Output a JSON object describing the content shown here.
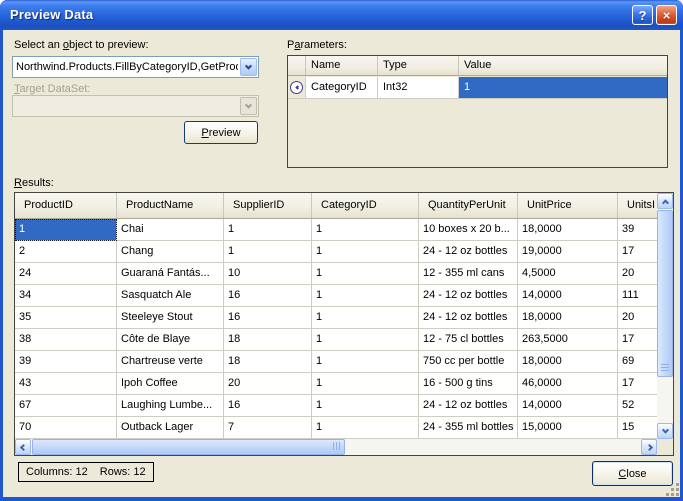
{
  "window": {
    "title": "Preview Data",
    "help_glyph": "?",
    "close_glyph": "×"
  },
  "select_object": {
    "label": {
      "pre": "Select an ",
      "key": "o",
      "post": "bject to preview:"
    },
    "value": "Northwind.Products.FillByCategoryID,GetProd"
  },
  "target_dataset": {
    "label": {
      "pre": "",
      "key": "T",
      "post": "arget DataSet:"
    },
    "value": ""
  },
  "preview_button": {
    "pre": "",
    "key": "P",
    "post": "review"
  },
  "parameters": {
    "label": {
      "pre": "P",
      "key": "a",
      "post": "rameters:"
    },
    "columns": [
      "Name",
      "Type",
      "Value"
    ],
    "row": {
      "name": "CategoryID",
      "type": "Int32",
      "value": "1"
    }
  },
  "results": {
    "label": {
      "pre": "",
      "key": "R",
      "post": "esults:"
    },
    "columns": [
      "ProductID",
      "ProductName",
      "SupplierID",
      "CategoryID",
      "QuantityPerUnit",
      "UnitPrice",
      "UnitsI"
    ],
    "rows": [
      [
        "1",
        "Chai",
        "1",
        "1",
        "10 boxes x 20 b...",
        "18,0000",
        "39"
      ],
      [
        "2",
        "Chang",
        "1",
        "1",
        "24 - 12 oz bottles",
        "19,0000",
        "17"
      ],
      [
        "24",
        "Guaraná Fantás...",
        "10",
        "1",
        "12 - 355 ml cans",
        "4,5000",
        "20"
      ],
      [
        "34",
        "Sasquatch Ale",
        "16",
        "1",
        "24 - 12 oz bottles",
        "14,0000",
        "111"
      ],
      [
        "35",
        "Steeleye Stout",
        "16",
        "1",
        "24 - 12 oz bottles",
        "18,0000",
        "20"
      ],
      [
        "38",
        "Côte de Blaye",
        "18",
        "1",
        "12 - 75 cl bottles",
        "263,5000",
        "17"
      ],
      [
        "39",
        "Chartreuse verte",
        "18",
        "1",
        "750 cc per bottle",
        "18,0000",
        "69"
      ],
      [
        "43",
        "Ipoh Coffee",
        "20",
        "1",
        "16 - 500 g tins",
        "46,0000",
        "17"
      ],
      [
        "67",
        "Laughing Lumbe...",
        "16",
        "1",
        "24 - 12 oz bottles",
        "14,0000",
        "52"
      ],
      [
        "70",
        "Outback Lager",
        "7",
        "1",
        "24 - 355 ml bottles",
        "15,0000",
        "15"
      ]
    ],
    "selected_cell": {
      "row": 0,
      "col": 0
    }
  },
  "status": {
    "columns_label": "Columns: 12",
    "rows_label": "Rows: 12"
  },
  "close_button": {
    "pre": "",
    "key": "C",
    "post": "lose"
  },
  "colors": {
    "selection": "#316AC5",
    "client_bg": "#ECE9D8",
    "titlebar_blue": "#2E6FE8"
  }
}
